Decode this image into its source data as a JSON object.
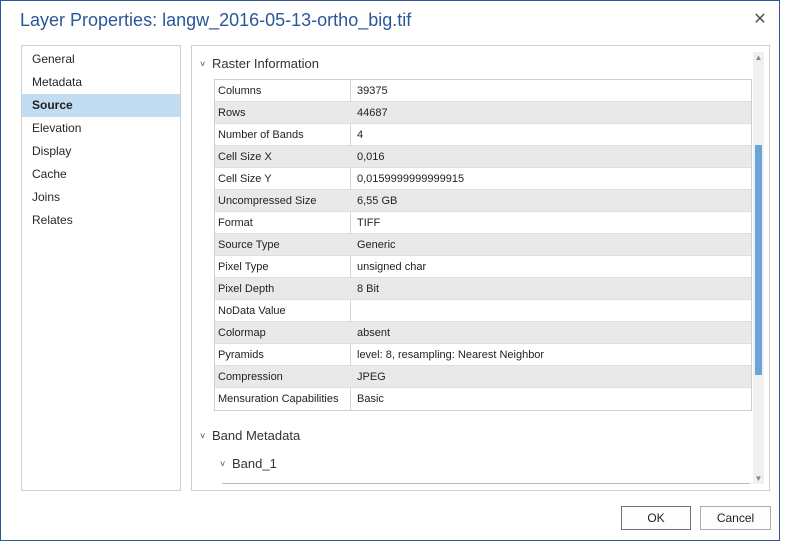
{
  "window": {
    "title": "Layer Properties: langw_2016-05-13-ortho_big.tif"
  },
  "nav": {
    "items": [
      {
        "label": "General"
      },
      {
        "label": "Metadata"
      },
      {
        "label": "Source",
        "active": true
      },
      {
        "label": "Elevation"
      },
      {
        "label": "Display"
      },
      {
        "label": "Cache"
      },
      {
        "label": "Joins"
      },
      {
        "label": "Relates"
      }
    ]
  },
  "raster_info": {
    "header": "Raster Information",
    "rows": [
      {
        "key": "Columns",
        "value": "39375"
      },
      {
        "key": "Rows",
        "value": "44687"
      },
      {
        "key": "Number of Bands",
        "value": "4"
      },
      {
        "key": "Cell Size X",
        "value": "0,016"
      },
      {
        "key": "Cell Size Y",
        "value": "0,0159999999999915"
      },
      {
        "key": "Uncompressed Size",
        "value": "6,55 GB"
      },
      {
        "key": "Format",
        "value": "TIFF"
      },
      {
        "key": "Source Type",
        "value": "Generic"
      },
      {
        "key": "Pixel Type",
        "value": "unsigned char"
      },
      {
        "key": "Pixel Depth",
        "value": "8 Bit"
      },
      {
        "key": "NoData Value",
        "value": ""
      },
      {
        "key": "Colormap",
        "value": "absent"
      },
      {
        "key": "Pyramids",
        "value": "level: 8, resampling: Nearest Neighbor"
      },
      {
        "key": "Compression",
        "value": "JPEG"
      },
      {
        "key": "Mensuration Capabilities",
        "value": "Basic"
      }
    ]
  },
  "band_metadata": {
    "header": "Band Metadata",
    "band_header": "Band_1"
  },
  "buttons": {
    "ok": "OK",
    "cancel": "Cancel"
  },
  "icons": {
    "close": "close-icon",
    "chevron": "chevron-down-icon"
  },
  "colors": {
    "accent": "#2b579a",
    "selection": "#c2dcf2",
    "scroll_thumb": "#6aa5d8"
  }
}
